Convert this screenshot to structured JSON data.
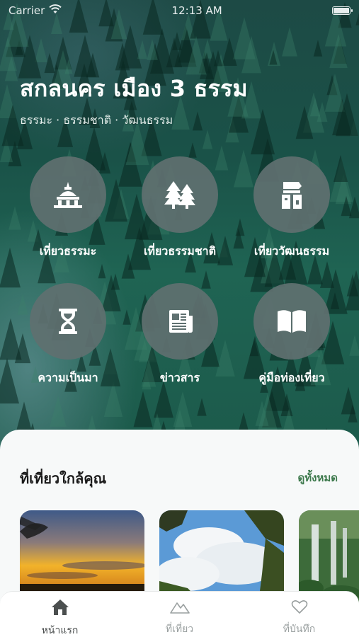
{
  "status_bar": {
    "carrier": "Carrier",
    "time": "12:13 AM"
  },
  "header": {
    "title": "สกลนคร เมือง 3 ธรรม",
    "subtitle": "ธรรมะ · ธรรมชาติ · วัฒนธรรม"
  },
  "menu": [
    {
      "label": "เที่ยวธรรมะ",
      "icon": "stupa-icon"
    },
    {
      "label": "เที่ยวธรรมชาติ",
      "icon": "trees-icon"
    },
    {
      "label": "เที่ยววัฒนธรรม",
      "icon": "culture-icon"
    },
    {
      "label": "ความเป็นมา",
      "icon": "hourglass-icon"
    },
    {
      "label": "ข่าวสาร",
      "icon": "newspaper-icon"
    },
    {
      "label": "คู่มือท่องเที่ยว",
      "icon": "book-icon"
    }
  ],
  "nearby": {
    "title": "ที่เที่ยวใกล้คุณ",
    "see_all": "ดูทั้งหมด",
    "cards": [
      {
        "image": "sunset-photo"
      },
      {
        "image": "sky-trees-photo"
      },
      {
        "image": "waterfall-photo"
      }
    ]
  },
  "tabbar": {
    "tabs": [
      {
        "label": "หน้าแรก",
        "icon": "home-icon",
        "active": true
      },
      {
        "label": "ที่เที่ยว",
        "icon": "mountain-icon",
        "active": false
      },
      {
        "label": "ที่บันทึก",
        "icon": "heart-icon",
        "active": false
      }
    ]
  },
  "colors": {
    "accent_green": "#3e7a4d",
    "circle_gray": "#5f7070",
    "sheet_bg": "#f7f9f9"
  }
}
